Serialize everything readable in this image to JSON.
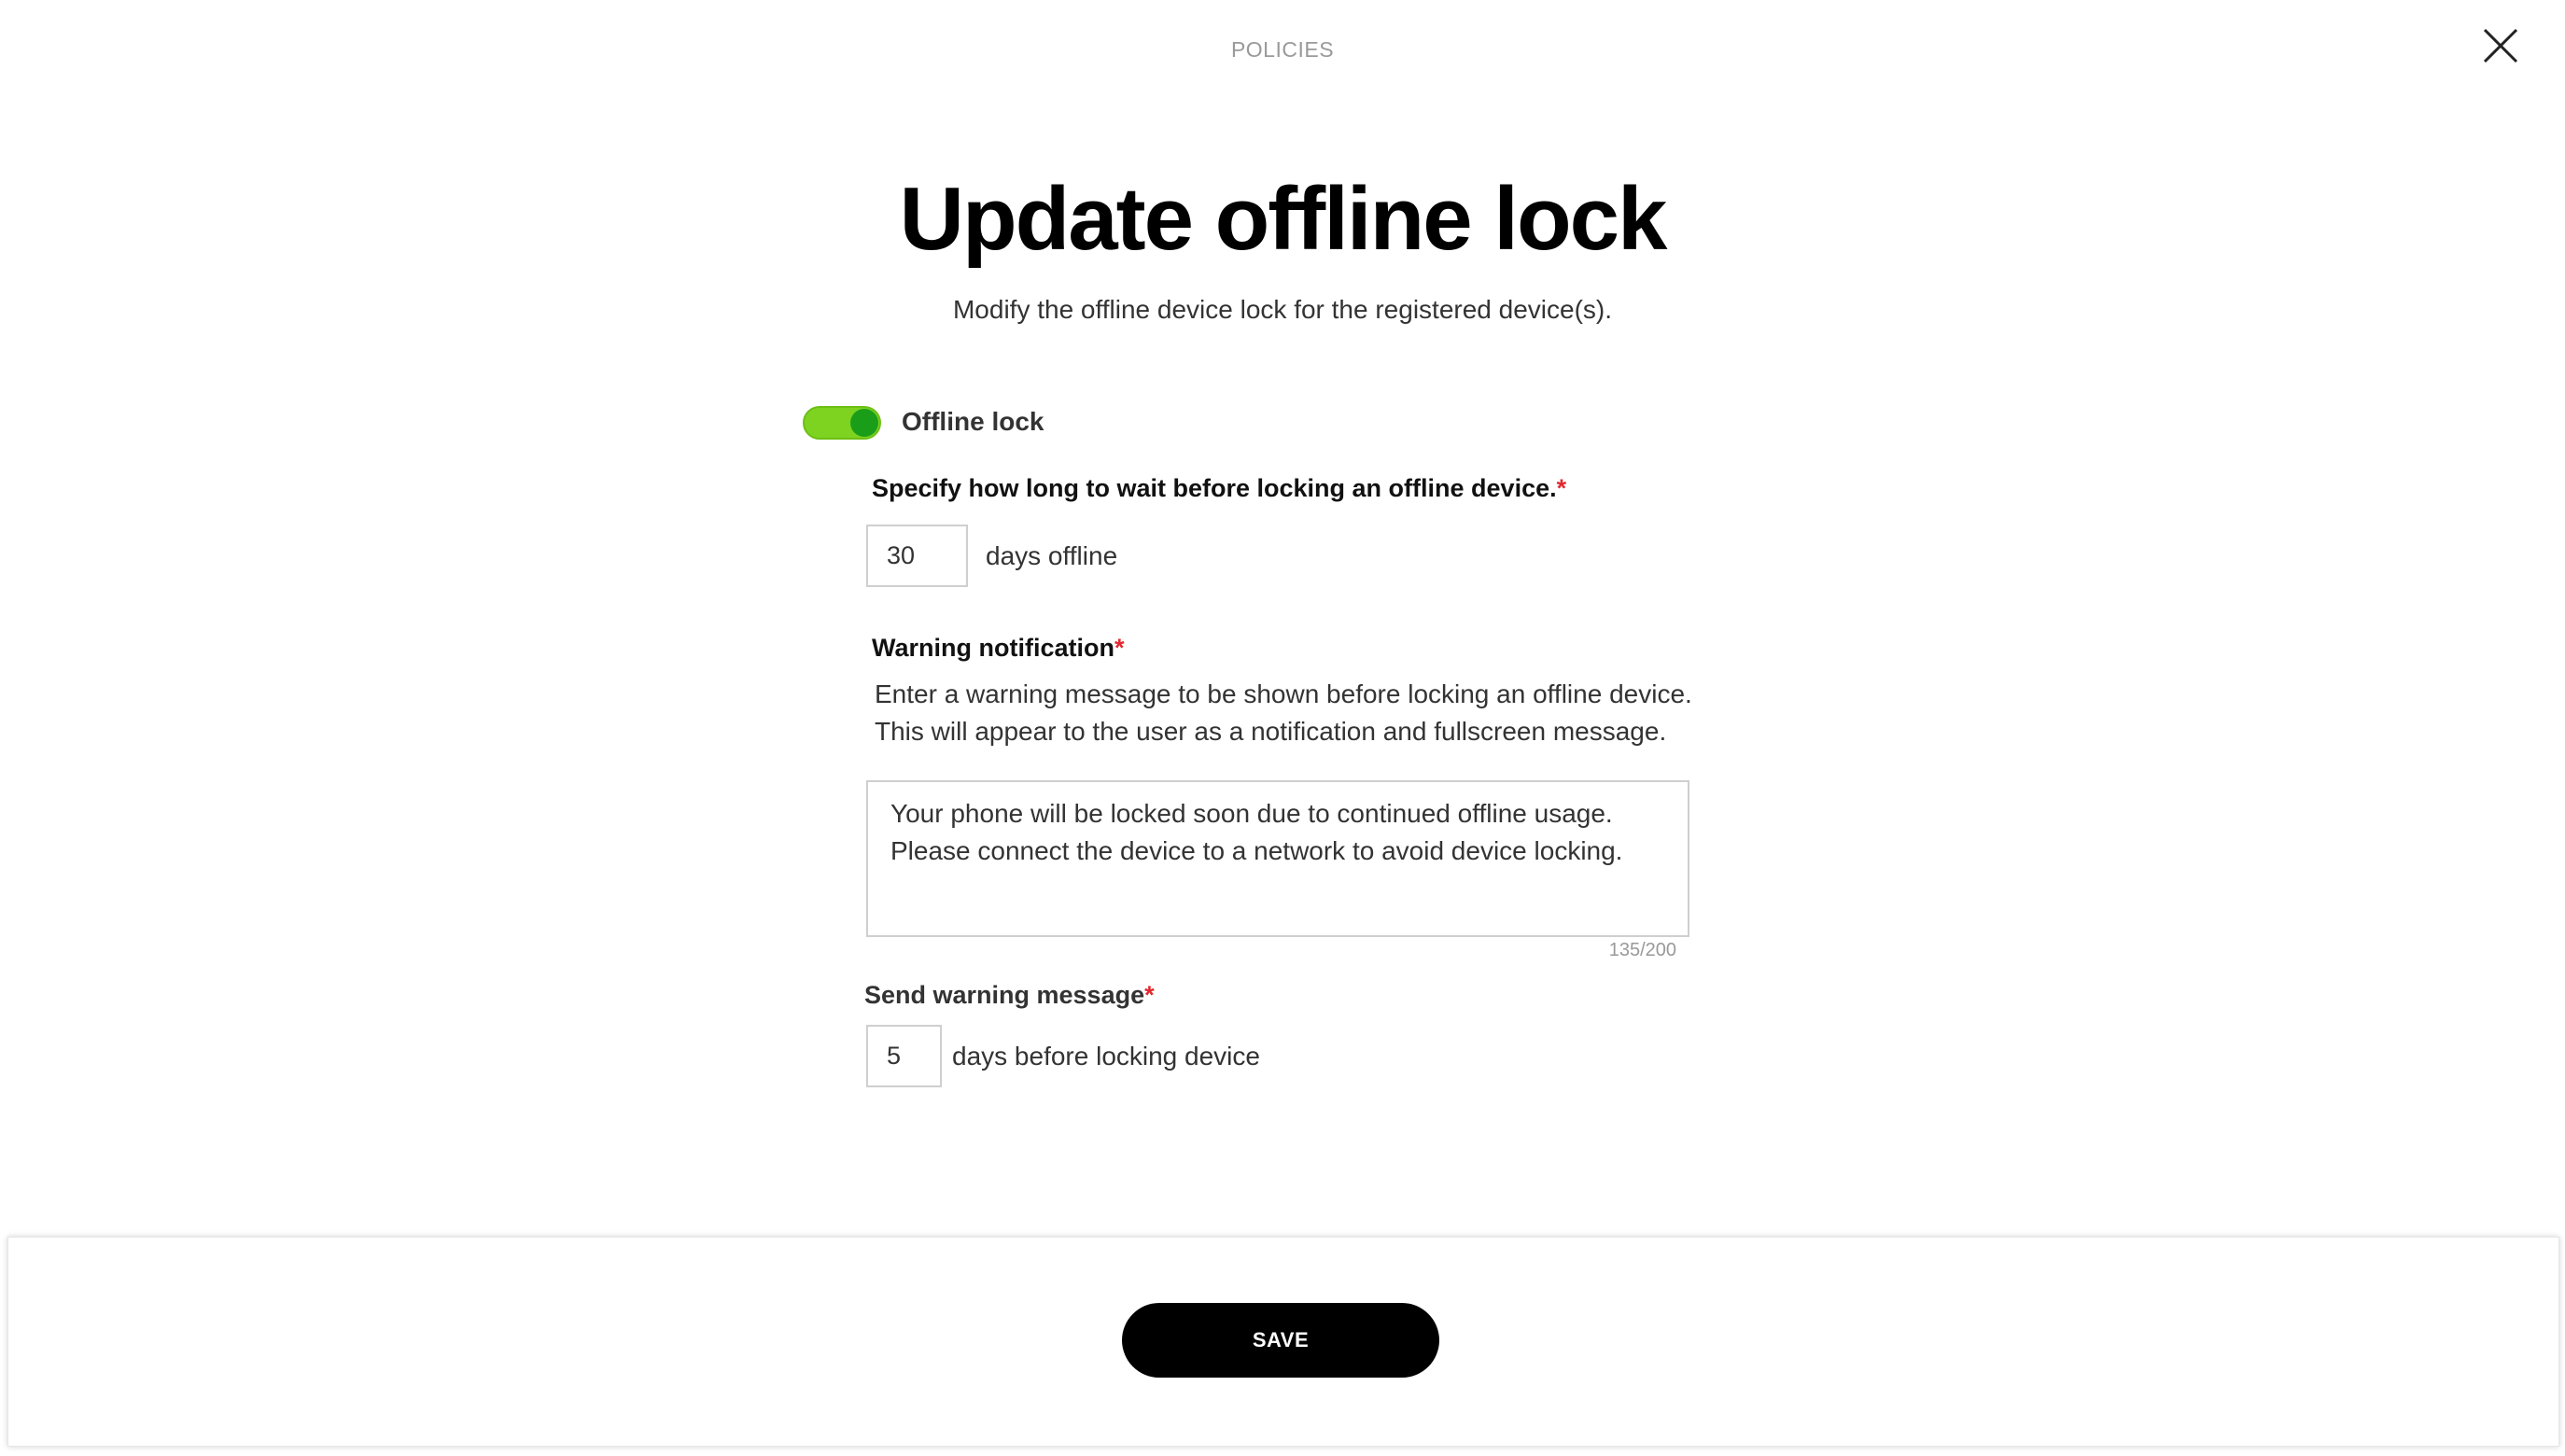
{
  "header": {
    "section_label": "POLICIES",
    "close_icon": "close-icon"
  },
  "dialog": {
    "title": "Update offline lock",
    "subtitle": "Modify the offline device lock for the registered device(s)."
  },
  "offline_lock": {
    "toggle_label": "Offline lock",
    "enabled": true,
    "toggle_color": "#7ed321"
  },
  "wait_period": {
    "label": "Specify how long to wait before locking an offline device.",
    "required_mark": "*",
    "value": "30",
    "unit": "days offline"
  },
  "warning_notification": {
    "label": "Warning notification",
    "required_mark": "*",
    "help_line_1": "Enter a warning message to be shown before locking an offline device.",
    "help_line_2": "This will appear to the user as a notification and fullscreen message.",
    "message": "Your phone will be locked soon due to continued offline usage.\nPlease connect the device to a network to avoid device locking.",
    "counter": "135/200"
  },
  "send_warning": {
    "label": "Send warning message",
    "required_mark": "*",
    "value": "5",
    "unit": "days before locking device"
  },
  "footer": {
    "save_label": "SAVE"
  },
  "colors": {
    "required": "#e0282e",
    "primary_button": "#000000"
  }
}
